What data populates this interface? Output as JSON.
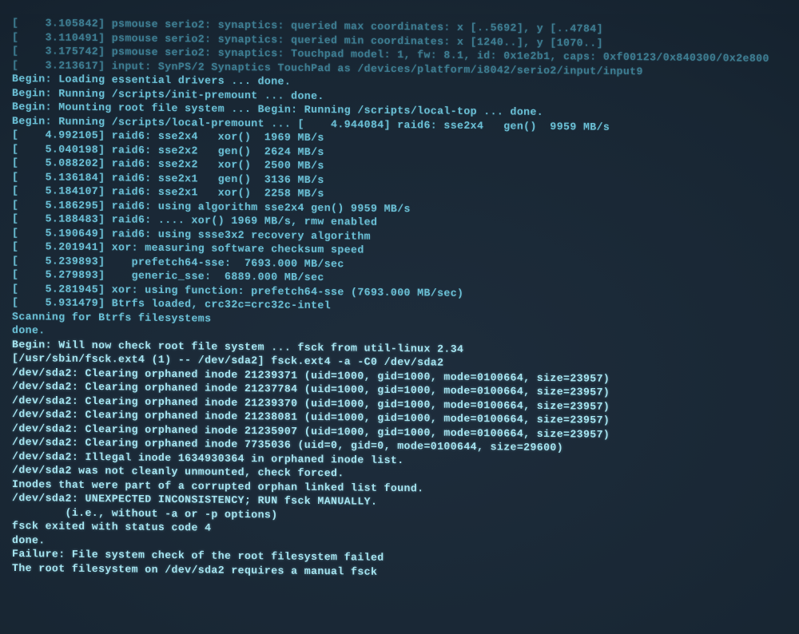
{
  "lines": [
    {
      "cls": "dim",
      "t": "[    3.105842] psmouse serio2: synaptics: queried max coordinates: x [..5692], y [..4784]"
    },
    {
      "cls": "dim",
      "t": "[    3.110491] psmouse serio2: synaptics: queried min coordinates: x [1240..], y [1070..]"
    },
    {
      "cls": "dim",
      "t": "[    3.175742] psmouse serio2: synaptics: Touchpad model: 1, fw: 8.1, id: 0x1e2b1, caps: 0xf00123/0x840300/0x2e800"
    },
    {
      "cls": "dim",
      "t": "[    3.213617] input: SynPS/2 Synaptics TouchPad as /devices/platform/i8042/serio2/input/input9"
    },
    {
      "cls": "line",
      "t": "Begin: Loading essential drivers ... done."
    },
    {
      "cls": "line",
      "t": "Begin: Running /scripts/init-premount ... done."
    },
    {
      "cls": "line",
      "t": "Begin: Mounting root file system ... Begin: Running /scripts/local-top ... done."
    },
    {
      "cls": "line",
      "t": "Begin: Running /scripts/local-premount ... [    4.944084] raid6: sse2x4   gen()  9959 MB/s"
    },
    {
      "cls": "line",
      "t": "[    4.992105] raid6: sse2x4   xor()  1969 MB/s"
    },
    {
      "cls": "line",
      "t": "[    5.040198] raid6: sse2x2   gen()  2624 MB/s"
    },
    {
      "cls": "line",
      "t": "[    5.088202] raid6: sse2x2   xor()  2500 MB/s"
    },
    {
      "cls": "line",
      "t": "[    5.136184] raid6: sse2x1   gen()  3136 MB/s"
    },
    {
      "cls": "line",
      "t": "[    5.184107] raid6: sse2x1   xor()  2258 MB/s"
    },
    {
      "cls": "line",
      "t": "[    5.186295] raid6: using algorithm sse2x4 gen() 9959 MB/s"
    },
    {
      "cls": "line",
      "t": "[    5.188483] raid6: .... xor() 1969 MB/s, rmw enabled"
    },
    {
      "cls": "line",
      "t": "[    5.190649] raid6: using ssse3x2 recovery algorithm"
    },
    {
      "cls": "line",
      "t": "[    5.201941] xor: measuring software checksum speed"
    },
    {
      "cls": "line",
      "t": "[    5.239893]    prefetch64-sse:  7693.000 MB/sec"
    },
    {
      "cls": "line",
      "t": "[    5.279893]    generic_sse:  6889.000 MB/sec"
    },
    {
      "cls": "line",
      "t": "[    5.281945] xor: using function: prefetch64-sse (7693.000 MB/sec)"
    },
    {
      "cls": "line",
      "t": "[    5.931479] Btrfs loaded, crc32c=crc32c-intel"
    },
    {
      "cls": "line",
      "t": "Scanning for Btrfs filesystems"
    },
    {
      "cls": "line",
      "t": "done."
    },
    {
      "cls": "bright",
      "t": "Begin: Will now check root file system ... fsck from util-linux 2.34"
    },
    {
      "cls": "bright",
      "t": "[/usr/sbin/fsck.ext4 (1) -- /dev/sda2] fsck.ext4 -a -C0 /dev/sda2"
    },
    {
      "cls": "bright",
      "t": "/dev/sda2: Clearing orphaned inode 21239371 (uid=1000, gid=1000, mode=0100664, size=23957)"
    },
    {
      "cls": "bright",
      "t": "/dev/sda2: Clearing orphaned inode 21237784 (uid=1000, gid=1000, mode=0100664, size=23957)"
    },
    {
      "cls": "bright",
      "t": "/dev/sda2: Clearing orphaned inode 21239370 (uid=1000, gid=1000, mode=0100664, size=23957)"
    },
    {
      "cls": "bright",
      "t": "/dev/sda2: Clearing orphaned inode 21238081 (uid=1000, gid=1000, mode=0100664, size=23957)"
    },
    {
      "cls": "bright",
      "t": "/dev/sda2: Clearing orphaned inode 21235907 (uid=1000, gid=1000, mode=0100664, size=23957)"
    },
    {
      "cls": "bright",
      "t": "/dev/sda2: Clearing orphaned inode 7735036 (uid=0, gid=0, mode=0100644, size=29600)"
    },
    {
      "cls": "bright",
      "t": "/dev/sda2: Illegal inode 1634930364 in orphaned inode list."
    },
    {
      "cls": "bright",
      "t": "/dev/sda2 was not cleanly unmounted, check forced."
    },
    {
      "cls": "bright",
      "t": "Inodes that were part of a corrupted orphan linked list found."
    },
    {
      "cls": "bright",
      "t": ""
    },
    {
      "cls": "bright",
      "t": "/dev/sda2: UNEXPECTED INCONSISTENCY; RUN fsck MANUALLY."
    },
    {
      "cls": "bright",
      "t": "        (i.e., without -a or -p options)"
    },
    {
      "cls": "bright",
      "t": "fsck exited with status code 4"
    },
    {
      "cls": "bright",
      "t": "done."
    },
    {
      "cls": "bright",
      "t": "Failure: File system check of the root filesystem failed"
    },
    {
      "cls": "bright",
      "t": "The root filesystem on /dev/sda2 requires a manual fsck"
    }
  ]
}
